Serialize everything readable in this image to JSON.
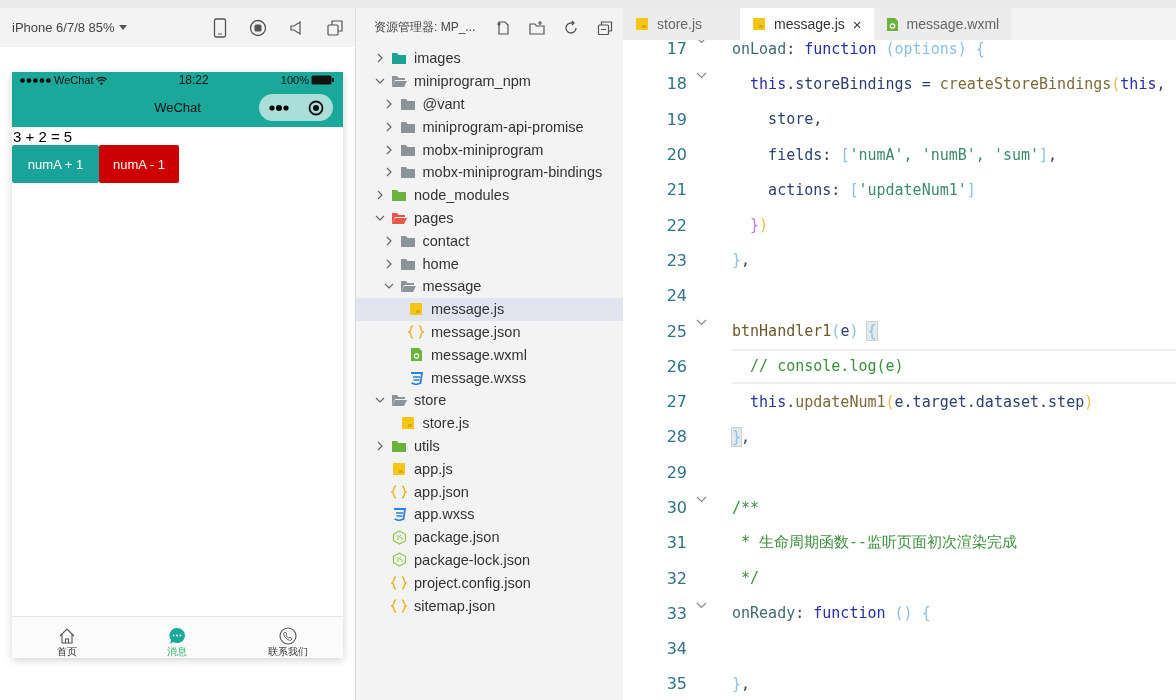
{
  "simulator": {
    "device": "iPhone 6/7/8 85%",
    "phone": {
      "carrier": "WeChat",
      "time": "18:22",
      "battery": "100%",
      "title": "WeChat",
      "result": "3 + 2 = 5",
      "buttons": [
        {
          "label": "numA + 1",
          "color": "#1aa39a"
        },
        {
          "label": "numA - 1",
          "color": "#cc0000"
        }
      ],
      "tabbar": [
        {
          "label": "首页",
          "kind": "home",
          "selected": false
        },
        {
          "label": "消息",
          "kind": "chat",
          "selected": true
        },
        {
          "label": "联系我们",
          "kind": "phone",
          "selected": false
        }
      ]
    }
  },
  "explorer": {
    "title": "资源管理器: MP_...",
    "tree": [
      {
        "label": "images",
        "kind": "folder",
        "color": "#1aa394",
        "expanded": false,
        "selected": false
      },
      {
        "label": "miniprogram_npm",
        "kind": "folder",
        "color": "#8a9499",
        "expanded": true,
        "selected": false,
        "children": [
          {
            "label": "@vant",
            "kind": "folder",
            "color": "#8a9499",
            "expanded": false,
            "selected": false
          },
          {
            "label": "miniprogram-api-promise",
            "kind": "folder",
            "color": "#8a9499",
            "expanded": false,
            "selected": false
          },
          {
            "label": "mobx-miniprogram",
            "kind": "folder",
            "color": "#8a9499",
            "expanded": false,
            "selected": false
          },
          {
            "label": "mobx-miniprogram-bindings",
            "kind": "folder",
            "color": "#8a9499",
            "expanded": false,
            "selected": false
          }
        ]
      },
      {
        "label": "node_modules",
        "kind": "folder",
        "color": "#6cb33e",
        "expanded": false,
        "selected": false
      },
      {
        "label": "pages",
        "kind": "folder",
        "color": "#e8584a",
        "expanded": true,
        "selected": false,
        "children": [
          {
            "label": "contact",
            "kind": "folder",
            "color": "#8a9499",
            "expanded": false,
            "selected": false
          },
          {
            "label": "home",
            "kind": "folder",
            "color": "#8a9499",
            "expanded": false,
            "selected": false
          },
          {
            "label": "message",
            "kind": "folder",
            "color": "#8a9499",
            "expanded": true,
            "selected": false,
            "children": [
              {
                "label": "message.js",
                "kind": "js",
                "selected": true
              },
              {
                "label": "message.json",
                "kind": "json",
                "selected": false
              },
              {
                "label": "message.wxml",
                "kind": "wxml",
                "selected": false
              },
              {
                "label": "message.wxss",
                "kind": "wxss",
                "selected": false
              }
            ]
          }
        ]
      },
      {
        "label": "store",
        "kind": "folder",
        "color": "#8a9499",
        "expanded": true,
        "selected": false,
        "children": [
          {
            "label": "store.js",
            "kind": "js",
            "selected": false
          }
        ]
      },
      {
        "label": "utils",
        "kind": "folder",
        "color": "#6cb33e",
        "expanded": false,
        "selected": false
      },
      {
        "label": "app.js",
        "kind": "js",
        "selected": false
      },
      {
        "label": "app.json",
        "kind": "json",
        "selected": false
      },
      {
        "label": "app.wxss",
        "kind": "wxss",
        "selected": false
      },
      {
        "label": "package.json",
        "kind": "npm",
        "selected": false
      },
      {
        "label": "package-lock.json",
        "kind": "npm",
        "selected": false
      },
      {
        "label": "project.config.json",
        "kind": "json",
        "selected": false
      },
      {
        "label": "sitemap.json",
        "kind": "json",
        "selected": false
      }
    ]
  },
  "editor": {
    "tabs": [
      {
        "label": "store.js",
        "kind": "js",
        "selected": false
      },
      {
        "label": "message.js",
        "kind": "js",
        "selected": true,
        "close": "×"
      },
      {
        "label": "message.wxml",
        "kind": "wxml",
        "selected": false
      }
    ],
    "lines": [
      {
        "number": "17",
        "foldable": true,
        "current": false,
        "tokens": [
          {
            "kind": "prop",
            "text": "onLoad"
          },
          {
            "kind": "punct",
            "text": ": "
          },
          {
            "kind": "kw",
            "text": "function"
          },
          {
            "kind": "br1",
            "text": " (options) {"
          }
        ]
      },
      {
        "number": "18",
        "foldable": true,
        "current": false,
        "tokens": [
          {
            "kind": "kw",
            "text": "  this"
          },
          {
            "kind": "var",
            "text": ".storeBindings = "
          },
          {
            "kind": "fn",
            "text": "createStoreBindings"
          },
          {
            "kind": "br2",
            "text": "("
          },
          {
            "kind": "kw",
            "text": "this"
          },
          {
            "kind": "punct",
            "text": ","
          }
        ]
      },
      {
        "number": "19",
        "foldable": false,
        "current": false,
        "tokens": [
          {
            "kind": "var",
            "text": "    store,"
          }
        ]
      },
      {
        "number": "20",
        "foldable": false,
        "current": false,
        "tokens": [
          {
            "kind": "var",
            "text": "    fields: "
          },
          {
            "kind": "br1",
            "text": "["
          },
          {
            "kind": "str",
            "text": "'numA', 'numB', 'sum'"
          },
          {
            "kind": "br1",
            "text": "]"
          },
          {
            "kind": "punct",
            "text": ","
          }
        ]
      },
      {
        "number": "21",
        "foldable": false,
        "current": false,
        "tokens": [
          {
            "kind": "var",
            "text": "    actions: "
          },
          {
            "kind": "br1",
            "text": "["
          },
          {
            "kind": "str",
            "text": "'updateNum1'"
          },
          {
            "kind": "br1",
            "text": "]"
          }
        ]
      },
      {
        "number": "22",
        "foldable": false,
        "current": false,
        "tokens": [
          {
            "kind": "br3",
            "text": "  }"
          },
          {
            "kind": "br2",
            "text": ")"
          }
        ]
      },
      {
        "number": "23",
        "foldable": false,
        "current": false,
        "tokens": [
          {
            "kind": "br1",
            "text": "}"
          },
          {
            "kind": "punct",
            "text": ","
          }
        ]
      },
      {
        "number": "24",
        "foldable": false,
        "current": false
      },
      {
        "number": "25",
        "foldable": true,
        "current": false,
        "tokens": [
          {
            "kind": "method",
            "text": "btnHandler1"
          },
          {
            "kind": "br1",
            "text": "("
          },
          {
            "kind": "var",
            "text": "e"
          },
          {
            "kind": "br1",
            "text": ") "
          },
          {
            "kind": "match",
            "text": "{"
          }
        ]
      },
      {
        "number": "26",
        "foldable": false,
        "current": true,
        "tokens": [
          {
            "kind": "comment",
            "text": "  // console.log(e)"
          }
        ]
      },
      {
        "number": "27",
        "foldable": false,
        "current": false,
        "tokens": [
          {
            "kind": "kw",
            "text": "  this"
          },
          {
            "kind": "punct",
            "text": "."
          },
          {
            "kind": "fn",
            "text": "updateNum1"
          },
          {
            "kind": "br2",
            "text": "("
          },
          {
            "kind": "var",
            "text": "e.target.dataset.step"
          },
          {
            "kind": "br2",
            "text": ")"
          }
        ]
      },
      {
        "number": "28",
        "foldable": false,
        "current": false,
        "tokens": [
          {
            "kind": "match",
            "text": "}"
          },
          {
            "kind": "punct",
            "text": ","
          }
        ]
      },
      {
        "number": "29",
        "foldable": false,
        "current": false
      },
      {
        "number": "30",
        "foldable": true,
        "current": false,
        "tokens": [
          {
            "kind": "comment",
            "text": "/**"
          }
        ]
      },
      {
        "number": "31",
        "foldable": false,
        "current": false,
        "tokens": [
          {
            "kind": "comment",
            "text": " * 生命周期函数--监听页面初次渲染完成"
          }
        ]
      },
      {
        "number": "32",
        "foldable": false,
        "current": false,
        "tokens": [
          {
            "kind": "comment",
            "text": " */"
          }
        ]
      },
      {
        "number": "33",
        "foldable": true,
        "current": false,
        "tokens": [
          {
            "kind": "prop",
            "text": "onReady"
          },
          {
            "kind": "punct",
            "text": ": "
          },
          {
            "kind": "kw",
            "text": "function"
          },
          {
            "kind": "br1",
            "text": " () {"
          }
        ]
      },
      {
        "number": "34",
        "foldable": false,
        "current": false
      },
      {
        "number": "35",
        "foldable": false,
        "current": false,
        "tokens": [
          {
            "kind": "br1",
            "text": "}"
          },
          {
            "kind": "punct",
            "text": ","
          }
        ]
      }
    ]
  }
}
